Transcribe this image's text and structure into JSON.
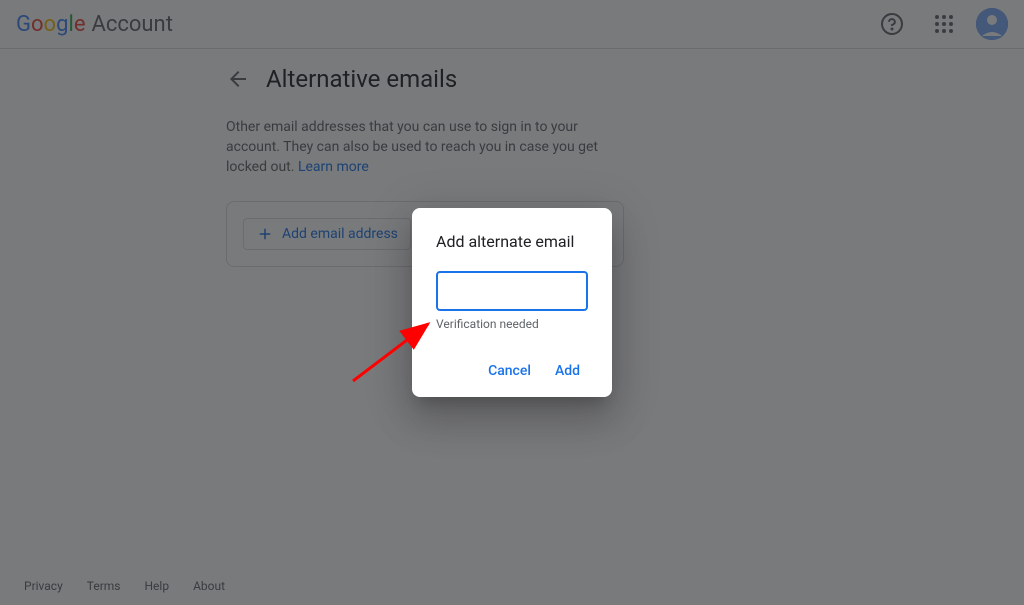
{
  "header": {
    "logo_google": "Google",
    "logo_account": "Account"
  },
  "page": {
    "title": "Alternative emails",
    "description": "Other email addresses that you can use to sign in to your account. They can also be used to reach you in case you get locked out.",
    "learn_more": "Learn more"
  },
  "card": {
    "add_email_label": "Add email address"
  },
  "dialog": {
    "title": "Add alternate email",
    "input_value": "",
    "helper": "Verification needed",
    "cancel_label": "Cancel",
    "add_label": "Add"
  },
  "footer": {
    "privacy": "Privacy",
    "terms": "Terms",
    "help": "Help",
    "about": "About"
  }
}
